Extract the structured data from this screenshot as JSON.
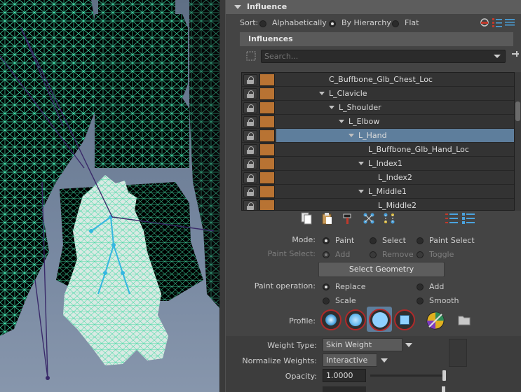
{
  "influence_header": {
    "label": "Influence"
  },
  "sort": {
    "label": "Sort:",
    "options": [
      "Alphabetically",
      "By Hierarchy",
      "Flat"
    ],
    "selected": "By Hierarchy"
  },
  "influences_header": {
    "label": "Influences"
  },
  "search": {
    "placeholder": "Search..."
  },
  "tree": {
    "rows": [
      {
        "name": "C_Buffbone_Glb_Chest_Loc",
        "expanded": false,
        "selected": false
      },
      {
        "name": "L_Clavicle",
        "expanded": true,
        "selected": false
      },
      {
        "name": "L_Shoulder",
        "expanded": true,
        "selected": false
      },
      {
        "name": "L_Elbow",
        "expanded": true,
        "selected": false
      },
      {
        "name": "L_Hand",
        "expanded": true,
        "selected": true
      },
      {
        "name": "L_Buffbone_Glb_Hand_Loc",
        "expanded": false,
        "selected": false
      },
      {
        "name": "L_Index1",
        "expanded": true,
        "selected": false
      },
      {
        "name": "L_Index2",
        "expanded": false,
        "selected": false
      },
      {
        "name": "L_Middle1",
        "expanded": true,
        "selected": false
      },
      {
        "name": "L_Middle2",
        "expanded": false,
        "selected": false
      }
    ],
    "swatch_color": "#b87333",
    "selected_color": "#5e7e9c"
  },
  "mode": {
    "label": "Mode:",
    "options": [
      "Paint",
      "Select",
      "Paint Select"
    ],
    "selected": "Paint"
  },
  "paint_select": {
    "label": "Paint Select:",
    "options": [
      "Add",
      "Remove",
      "Toggle"
    ],
    "selected": "Add",
    "enabled": false
  },
  "select_geometry_button": "Select Geometry",
  "paint_operation": {
    "label": "Paint operation:",
    "options": [
      "Replace",
      "Add",
      "Scale",
      "Smooth"
    ],
    "selected": "Replace"
  },
  "profile": {
    "label": "Profile:",
    "selected_index": 2
  },
  "weight_type": {
    "label": "Weight Type:",
    "value": "Skin Weight"
  },
  "normalize_weights": {
    "label": "Normalize Weights:",
    "value": "Interactive"
  },
  "opacity": {
    "label": "Opacity:",
    "value": "1.0000",
    "level": 1.0
  },
  "colors": {
    "accent_red": "#b02a2a",
    "wire": "#55f0b8",
    "panel_bg": "#444444"
  }
}
